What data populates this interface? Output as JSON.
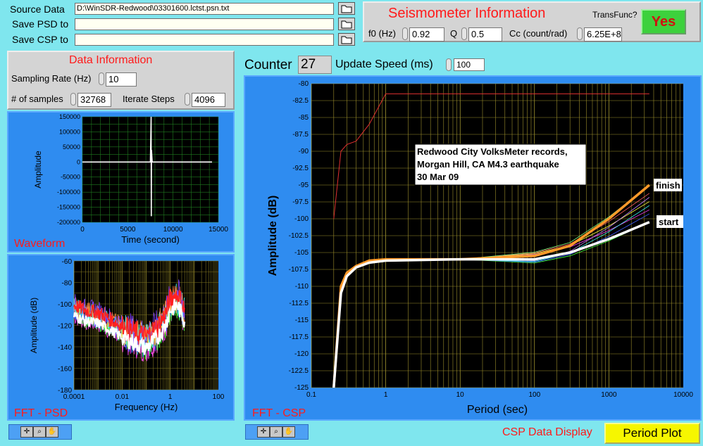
{
  "files": {
    "source_label": "Source Data",
    "source_value": "D:\\WinSDR-Redwood\\03301600.lctst.psn.txt",
    "psd_label": "Save PSD to",
    "psd_value": "",
    "csp_label": "Save CSP to",
    "csp_value": ""
  },
  "seismometer": {
    "title": "Seismometer Information",
    "transfunc_label": "TransFunc?",
    "transfunc_value": "Yes",
    "f0_label": "f0 (Hz)",
    "f0_value": "0.92",
    "q_label": "Q",
    "q_value": "0.5",
    "cc_label": "Cc (count/rad)",
    "cc_value": "6.25E+8"
  },
  "data_info": {
    "title": "Data Information",
    "sampling_label": "Sampling Rate (Hz)",
    "sampling_value": "10",
    "samples_label": "# of samples",
    "samples_value": "32768",
    "iterate_label": "Iterate Steps",
    "iterate_value": "4096"
  },
  "counter": {
    "label": "Counter",
    "value": "27",
    "speed_label": "Update Speed (ms)",
    "speed_value": "100"
  },
  "waveform": {
    "panel_label": "Waveform",
    "xlabel": "Time (second)",
    "ylabel": "Amplitude",
    "xticks": [
      "0",
      "5000",
      "10000",
      "15000"
    ],
    "yticks": [
      "150000",
      "100000",
      "50000",
      "0",
      "-50000",
      "-100000",
      "-150000",
      "-200000"
    ]
  },
  "psd": {
    "panel_label": "FFT - PSD",
    "xlabel": "Frequency (Hz)",
    "ylabel": "Amplitude (dB)",
    "xticks": [
      "0.0001",
      "0.01",
      "1",
      "100"
    ],
    "yticks": [
      "-60",
      "-80",
      "-100",
      "-120",
      "-140",
      "-160",
      "-180"
    ]
  },
  "csp": {
    "panel_label": "FFT - CSP",
    "xlabel": "Period (sec)",
    "ylabel": "Amplitude (dB)",
    "xticks": [
      "0.1",
      "1",
      "10",
      "100",
      "1000",
      "10000"
    ],
    "yticks": [
      "-80",
      "-82.5",
      "-85",
      "-87.5",
      "-90",
      "-92.5",
      "-95",
      "-97.5",
      "-100",
      "-102.5",
      "-105",
      "-107.5",
      "-110",
      "-112.5",
      "-115",
      "-117.5",
      "-120",
      "-122.5",
      "-125"
    ],
    "annotation": [
      "Redwood City VolksMeter records,",
      "Morgan Hill, CA M4.3 earthquake",
      "30 Mar 09"
    ],
    "finish_label": "finish",
    "start_label": "start"
  },
  "display": {
    "label": "CSP Data Display",
    "value": "Period Plot"
  },
  "colors": {
    "background": "#7fe6ee",
    "panel_blue": "#2f8cf0",
    "plot_black": "#000000",
    "grid_green": "#1f7a1f",
    "csp_grid": "#b7a635",
    "yes_green": "#3dd13d",
    "period_yellow": "#f6f600"
  },
  "chart_data": [
    {
      "type": "line",
      "name_hint": "waveform",
      "xlabel": "Time (second)",
      "ylabel": "Amplitude",
      "xlim": [
        0,
        15000
      ],
      "ylim": [
        -200000,
        150000
      ],
      "x": [
        0,
        7500,
        7580,
        7600,
        7620,
        7700,
        14300
      ],
      "y": [
        0,
        0,
        150000,
        -180000,
        40000,
        0,
        0
      ]
    },
    {
      "type": "line",
      "name_hint": "psd",
      "xlabel": "Frequency (Hz)",
      "ylabel": "Amplitude (dB)",
      "xscale": "log",
      "xlim": [
        0.0001,
        100
      ],
      "ylim": [
        -180,
        -60
      ],
      "x": [
        0.0001,
        0.0003,
        0.001,
        0.003,
        0.01,
        0.03,
        0.1,
        0.3,
        0.6,
        1,
        2,
        4
      ],
      "y": [
        -105,
        -110,
        -112,
        -118,
        -125,
        -130,
        -135,
        -125,
        -115,
        -100,
        -95,
        -110
      ]
    },
    {
      "type": "line",
      "name_hint": "csp",
      "xlabel": "Period (sec)",
      "ylabel": "Amplitude (dB)",
      "xscale": "log",
      "xlim": [
        0.1,
        10000
      ],
      "ylim": [
        -125,
        -80
      ],
      "x": [
        0.2,
        0.25,
        0.3,
        0.4,
        0.6,
        1,
        10,
        100,
        300,
        1000,
        3500
      ],
      "series": [
        {
          "y": [
            -125,
            -110,
            -108,
            -107,
            -106.2,
            -106,
            -106,
            -105.5,
            -104,
            -100,
            -95
          ]
        },
        {
          "y": [
            -125,
            -111,
            -108.5,
            -107.2,
            -106.5,
            -106.2,
            -106,
            -106,
            -105,
            -103,
            -100.5
          ]
        },
        {
          "y": [
            -100,
            -90,
            -89,
            -88.5,
            -86,
            -81.5,
            -81.5,
            -81.5,
            -81.5,
            -81.5,
            -81.5
          ]
        }
      ]
    }
  ]
}
